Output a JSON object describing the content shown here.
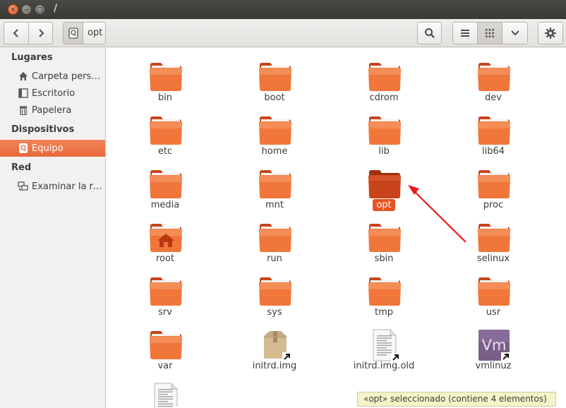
{
  "window": {
    "title": "/"
  },
  "toolbar": {
    "path_segment": "opt"
  },
  "sidebar": {
    "sections": [
      {
        "heading": "Lugares",
        "items": [
          {
            "label": "Carpeta perso…",
            "icon": "home-icon"
          },
          {
            "label": "Escritorio",
            "icon": "desktop-icon"
          },
          {
            "label": "Papelera",
            "icon": "trash-icon"
          }
        ]
      },
      {
        "heading": "Dispositivos",
        "items": [
          {
            "label": "Equipo",
            "icon": "computer-icon",
            "selected": true
          }
        ]
      },
      {
        "heading": "Red",
        "items": [
          {
            "label": "Examinar la red",
            "icon": "network-icon"
          }
        ]
      }
    ]
  },
  "files": [
    {
      "name": "bin",
      "type": "folder"
    },
    {
      "name": "boot",
      "type": "folder"
    },
    {
      "name": "cdrom",
      "type": "folder"
    },
    {
      "name": "dev",
      "type": "folder"
    },
    {
      "name": "etc",
      "type": "folder"
    },
    {
      "name": "home",
      "type": "folder"
    },
    {
      "name": "lib",
      "type": "folder"
    },
    {
      "name": "lib64",
      "type": "folder"
    },
    {
      "name": "media",
      "type": "folder"
    },
    {
      "name": "mnt",
      "type": "folder"
    },
    {
      "name": "opt",
      "type": "folder",
      "selected": true
    },
    {
      "name": "proc",
      "type": "folder"
    },
    {
      "name": "root",
      "type": "folder-home"
    },
    {
      "name": "run",
      "type": "folder"
    },
    {
      "name": "sbin",
      "type": "folder"
    },
    {
      "name": "selinux",
      "type": "folder"
    },
    {
      "name": "srv",
      "type": "folder"
    },
    {
      "name": "sys",
      "type": "folder"
    },
    {
      "name": "tmp",
      "type": "folder"
    },
    {
      "name": "usr",
      "type": "folder"
    },
    {
      "name": "var",
      "type": "folder"
    },
    {
      "name": "initrd.img",
      "type": "package-link"
    },
    {
      "name": "initrd.img.old",
      "type": "document-link"
    },
    {
      "name": "vmlinuz",
      "type": "vm-link",
      "icon_text": "Vm"
    },
    {
      "name": "",
      "type": "document-link"
    }
  ],
  "status": {
    "text": "«opt» seleccionado  (contiene 4 elementos)"
  },
  "colors": {
    "accent": "#e95420",
    "folder": "#f0763a",
    "titlebar": "#3c3b37"
  }
}
